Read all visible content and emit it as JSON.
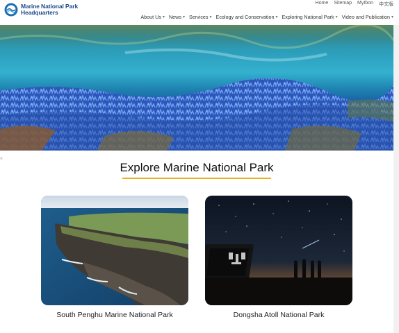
{
  "header": {
    "logo_line1": "Marine National Park",
    "logo_line2": "Headquarters",
    "utility_links": [
      "Home",
      "Sitemap",
      "MyIbon",
      "中文版"
    ],
    "nav": [
      {
        "label": "About Us",
        "has_dropdown": true
      },
      {
        "label": "News",
        "has_dropdown": true
      },
      {
        "label": "Services",
        "has_dropdown": true
      },
      {
        "label": "Ecology and Conservation",
        "has_dropdown": true
      },
      {
        "label": "Exploring National Park",
        "has_dropdown": true
      },
      {
        "label": "Video and Publication",
        "has_dropdown": true
      }
    ]
  },
  "hero": {
    "icon": "coral-reef-photo"
  },
  "main": {
    "section_title": "Explore Marine National Park",
    "accent_color": "#e5b422",
    "cards": [
      {
        "label": "South Penghu Marine National Park",
        "icon": "penghu-coast-photo"
      },
      {
        "label": "Dongsha Atoll National Park",
        "icon": "dongsha-night-sky-photo"
      }
    ]
  },
  "colors": {
    "brand": "#1b4a8c",
    "ocean": "#1a7fae"
  }
}
